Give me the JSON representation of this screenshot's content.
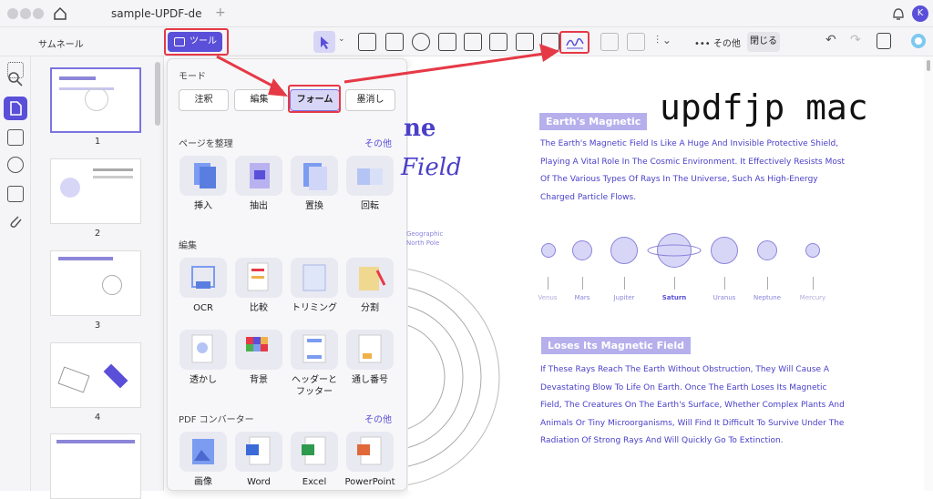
{
  "tab_title": "sample-UPDF-de",
  "user_initial": "K",
  "toolbar": {
    "more_label": "その他",
    "close_label": "閉じる"
  },
  "thumb_panel": {
    "title": "サムネール",
    "pages": [
      "1",
      "2",
      "3",
      "4"
    ]
  },
  "tools_button": "ツール",
  "mode": {
    "label": "モード",
    "buttons": [
      "注釈",
      "編集",
      "フォーム",
      "墨消し"
    ]
  },
  "organize": {
    "label": "ページを整理",
    "more": "その他",
    "items": [
      "挿入",
      "抽出",
      "置換",
      "回転"
    ]
  },
  "edit": {
    "label": "編集",
    "row1": [
      "OCR",
      "比較",
      "トリミング",
      "分割"
    ],
    "row2": [
      "透かし",
      "背景",
      "ヘッダーと\nフッター",
      "通し番号"
    ]
  },
  "converter": {
    "label": "PDF コンバーター",
    "more": "その他",
    "items": [
      "画像",
      "Word",
      "Excel",
      "PowerPoint"
    ]
  },
  "document": {
    "title_fragment_1": "ne",
    "title_fragment_2": "Field",
    "handwriting": "updfjp mac",
    "pole_label": "Geographic\nNorth Pole",
    "sec1": {
      "title": "Earth's Magnetic",
      "lines": [
        "The Earth's Magnetic Field Is Like A Huge And Invisible Protective Shield,",
        "Playing A Vital Role In The Cosmic Environment. It Effectively Resists Most",
        "Of The Various Types Of Rays In The Universe, Such As High-Energy",
        "Charged Particle Flows."
      ]
    },
    "planets": [
      "Venus",
      "Mars",
      "Jupiter",
      "Saturn",
      "Uranus",
      "Neptune",
      "Mercury"
    ],
    "sec2": {
      "title": "Loses Its Magnetic Field",
      "lines": [
        "If These Rays Reach The Earth Without Obstruction, They Will Cause A",
        "Devastating Blow To Life On Earth. Once The Earth Loses Its Magnetic",
        "Field, The Creatures On The Earth's Surface, Whether Complex Plants And",
        "Animals Or Tiny Microorganisms, Will Find It Difficult To Survive Under The",
        "Radiation Of Strong Rays And Will Quickly Go To Extinction."
      ]
    }
  },
  "colors": {
    "accent": "#5a4fd8",
    "highlight": "#e63946"
  }
}
